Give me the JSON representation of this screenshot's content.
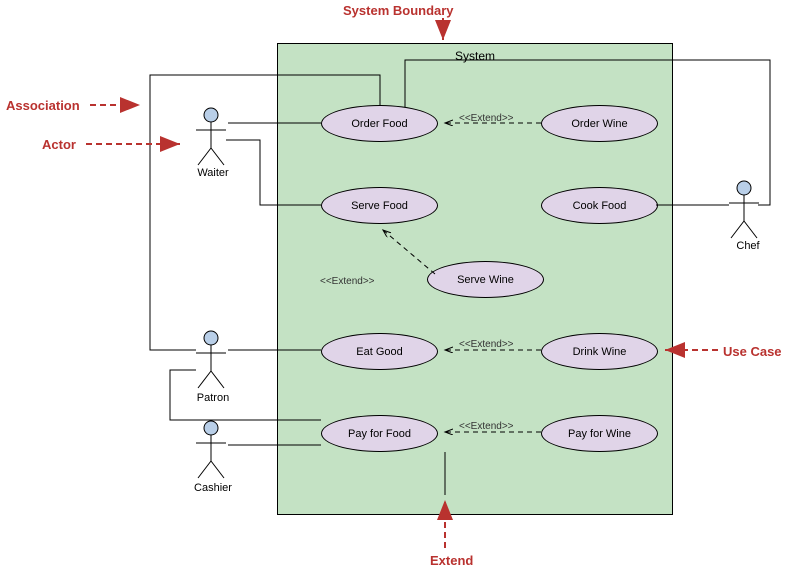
{
  "labels": {
    "system_boundary": "System Boundary",
    "association": "Association",
    "actor": "Actor",
    "use_case": "Use Case",
    "extend_label": "Extend",
    "system_title": "System"
  },
  "actors": {
    "waiter": "Waiter",
    "patron": "Patron",
    "cashier": "Cashier",
    "chef": "Chef"
  },
  "usecases": {
    "order_food": "Order Food",
    "order_wine": "Order Wine",
    "serve_food": "Serve Food",
    "cook_food": "Cook Food",
    "serve_wine": "Serve Wine",
    "eat_good": "Eat Good",
    "drink_wine": "Drink Wine",
    "pay_food": "Pay for Food",
    "pay_wine": "Pay for Wine"
  },
  "stereotype": "<<Extend>>"
}
